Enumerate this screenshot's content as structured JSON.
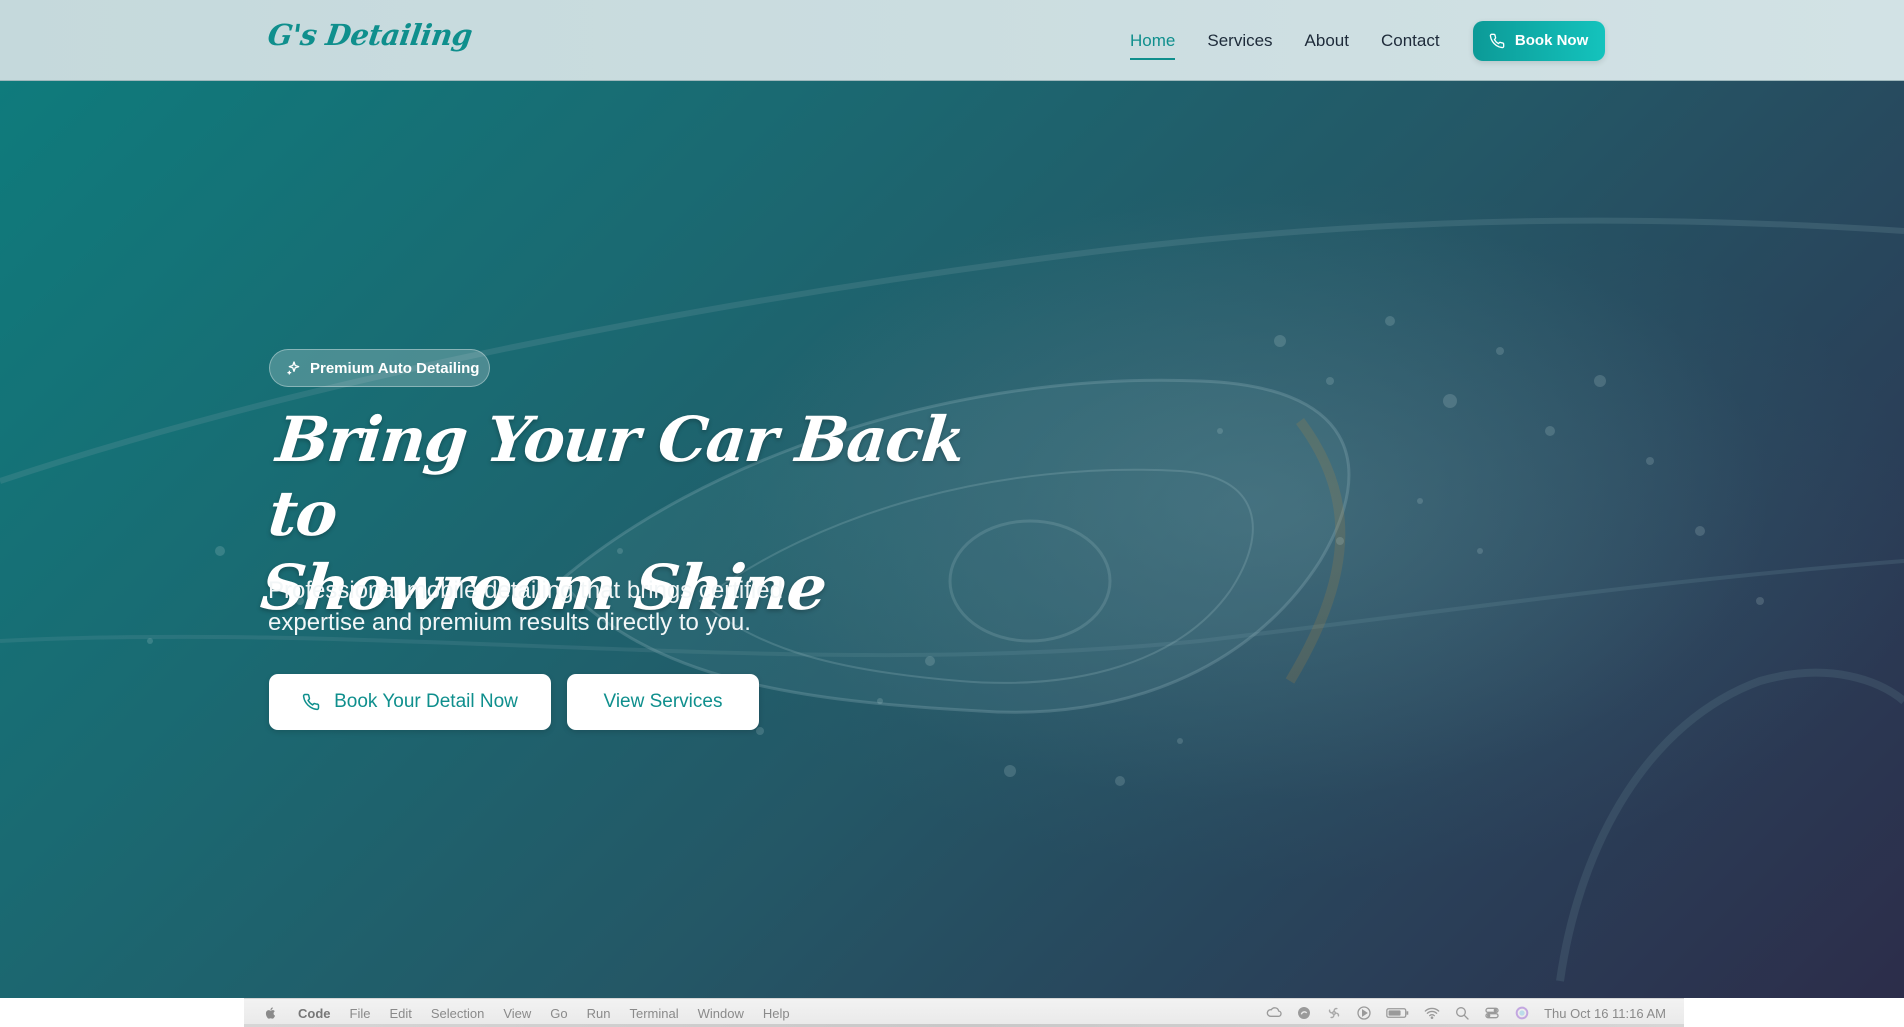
{
  "brand": {
    "logo_text": "G's Detailing",
    "accent_color": "#0f8f8d",
    "accent_light": "#14c3bd"
  },
  "nav": {
    "items": [
      {
        "label": "Home",
        "active": true
      },
      {
        "label": "Services",
        "active": false
      },
      {
        "label": "About",
        "active": false
      },
      {
        "label": "Contact",
        "active": false
      }
    ],
    "book_label": "Book Now",
    "book_icon": "phone-icon"
  },
  "hero": {
    "badge": {
      "label": "Premium Auto Detailing",
      "icon": "sparkles-icon"
    },
    "title_line1": "Bring Your Car Back to",
    "title_line2": "Showroom Shine",
    "subtitle_line1": "Professional mobile detailing that brings certified",
    "subtitle_line2": "expertise and premium results directly to you.",
    "primary_cta": {
      "label": "Book Your Detail Now",
      "icon": "phone-icon"
    },
    "secondary_cta": {
      "label": "View Services"
    },
    "background": "car-headlight-photo"
  },
  "menubar": {
    "apple_icon": "apple-icon",
    "app_name": "Code",
    "items": [
      "File",
      "Edit",
      "Selection",
      "View",
      "Go",
      "Run",
      "Terminal",
      "Window",
      "Help"
    ],
    "status_icons": [
      "creative-cloud-icon",
      "edge-icon",
      "fan-icon",
      "play-icon",
      "battery-icon",
      "wifi-icon",
      "search-icon",
      "control-center-icon",
      "siri-icon"
    ],
    "clock": "Thu Oct 16  11:16 AM"
  }
}
